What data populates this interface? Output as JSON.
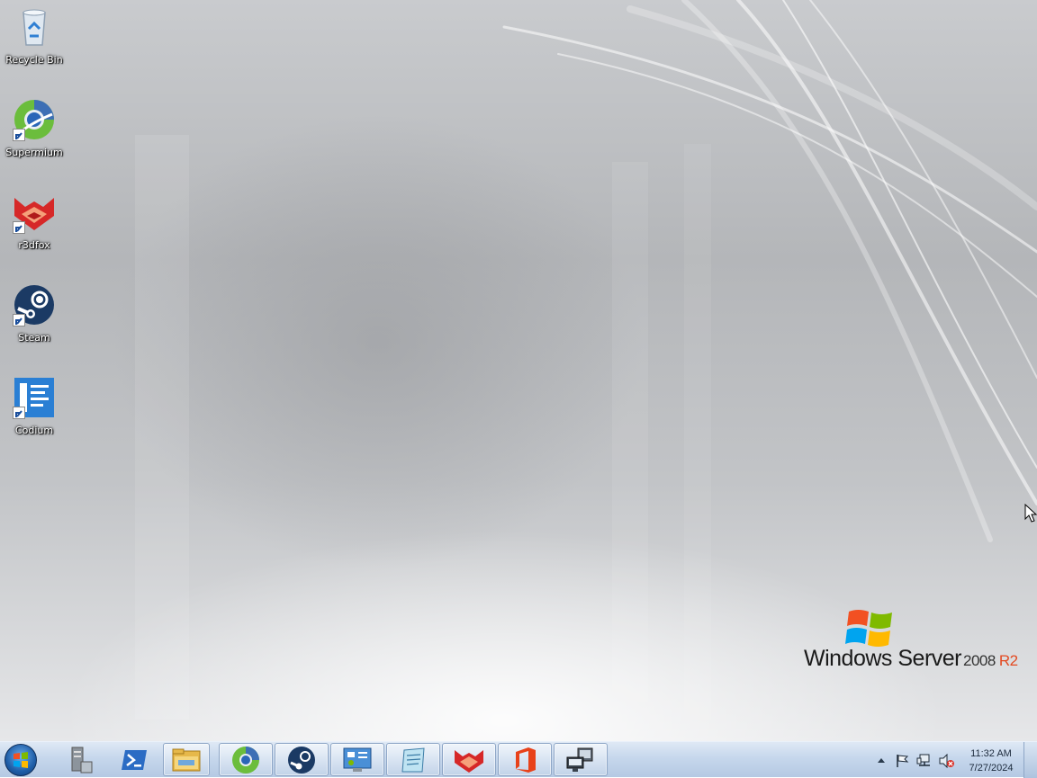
{
  "desktop": {
    "icons": [
      {
        "label": "Recycle Bin",
        "icon": "recycle-bin-icon"
      },
      {
        "label": "Supermium",
        "icon": "supermium-icon"
      },
      {
        "label": "r3dfox",
        "icon": "r3dfox-icon"
      },
      {
        "label": "Steam",
        "icon": "steam-icon"
      },
      {
        "label": "Codium",
        "icon": "codium-icon"
      }
    ],
    "branding": {
      "part1": "Windows Server",
      "part2": "2008",
      "part3": "R2"
    }
  },
  "taskbar": {
    "pinned": [
      "server-manager-icon",
      "powershell-icon",
      "file-explorer-icon",
      "supermium-icon",
      "steam-icon",
      "control-panel-icon",
      "notepad-icon",
      "r3dfox-icon",
      "office-icon",
      "remote-desktop-icon"
    ],
    "tray": {
      "time": "11:32 AM",
      "date": "7/27/2024"
    }
  },
  "colors": {
    "brand_r2": "#e34a22",
    "taskbar": "#c6d7ec"
  }
}
